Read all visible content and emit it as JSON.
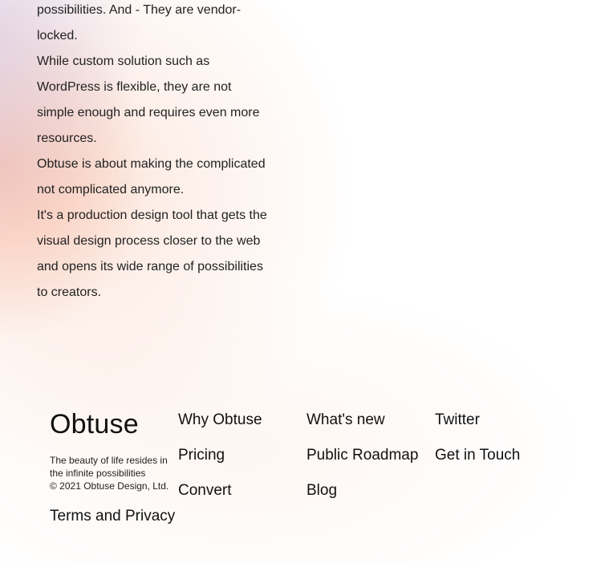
{
  "about": {
    "paragraphs": [
      "possibilities. And - They are vendor-locked.",
      "While custom solution such as WordPress is flexible, they are not simple enough and requires even more resources.",
      "Obtuse is about making the complicated not complicated anymore.",
      "It's a production design tool that gets the visual design process closer to the web and opens its wide range of possibilities to creators."
    ]
  },
  "footer": {
    "brand": "Obtuse",
    "tagline": "The beauty of life resides in the infinite possibilities",
    "copyright": "© 2021 Obtuse Design, Ltd.",
    "terms": "Terms and Privacy",
    "columns": [
      {
        "links": [
          "Why Obtuse",
          "Pricing",
          "Convert"
        ]
      },
      {
        "links": [
          "What's new",
          "Public Roadmap",
          "Blog"
        ]
      },
      {
        "links": [
          "Twitter",
          "Get in Touch"
        ]
      }
    ]
  }
}
